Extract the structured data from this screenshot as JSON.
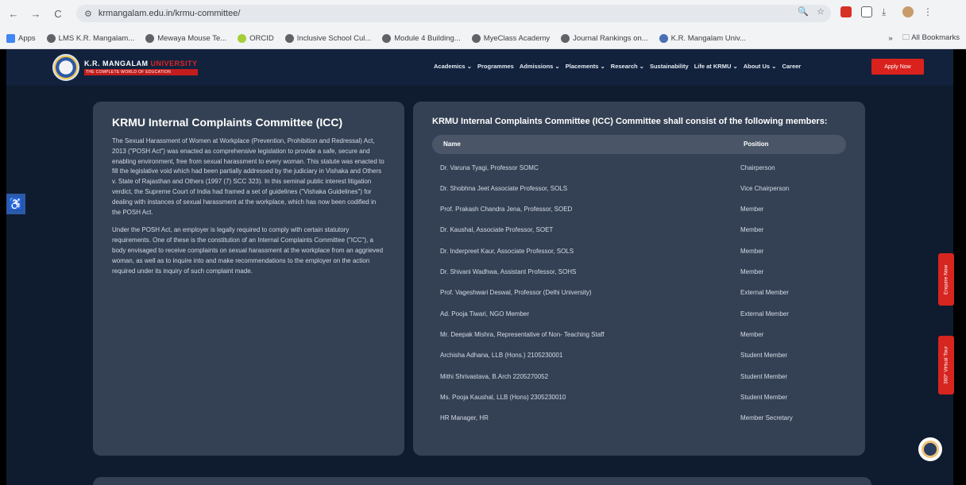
{
  "browser": {
    "url": "krmangalam.edu.in/krmu-committee/",
    "nav_back": "←",
    "nav_forward": "→",
    "nav_reload": "C",
    "site_info_icon": "tune-icon",
    "omni_icons": [
      "🔍",
      "☆"
    ],
    "bookmarks": [
      {
        "label": "Apps",
        "color": "#4285f4"
      },
      {
        "label": "LMS K.R. Mangalam...",
        "color": "#5f6368"
      },
      {
        "label": "Mewaya Mouse Te...",
        "color": "#5f6368"
      },
      {
        "label": "ORCID",
        "color": "#a6ce39"
      },
      {
        "label": "Inclusive School Cul...",
        "color": "#5f6368"
      },
      {
        "label": "Module 4 Building...",
        "color": "#5f6368"
      },
      {
        "label": "MyeClass Academy",
        "color": "#5f6368"
      },
      {
        "label": "Journal Rankings on...",
        "color": "#5f6368"
      },
      {
        "label": "K.R. Mangalam Univ...",
        "color": "#4a6fb5"
      }
    ],
    "all_bookmarks": "All Bookmarks"
  },
  "header": {
    "logo_top_a": "K.R. MANGALAM ",
    "logo_top_b": "UNIVERSITY",
    "logo_tagline": "THE COMPLETE WORLD OF EDUCATION",
    "nav": [
      "Academics ⌄",
      "Programmes",
      "Admissions ⌄",
      "Placements ⌄",
      "Research ⌄",
      "Sustainability",
      "Life at KRMU ⌄",
      "About Us ⌄",
      "Career"
    ],
    "apply_label": "Apply Now"
  },
  "left_card": {
    "title": "KRMU Internal Complaints Committee (ICC)",
    "para1": "The Sexual Harassment of Women at Workplace (Prevention, Prohibition and Redressal) Act, 2013 (\"POSH Act\") was enacted as comprehensive legislation to provide a safe, secure and enabling environment, free from sexual harassment to every woman. This statute was enacted to fill the legislative void which had been partially addressed by the judiciary in Vishaka and Others v. State of Rajasthan and Others (1997 (7) SCC 323). In this seminal public interest litigation verdict, the Supreme Court of India had framed a set of guidelines (\"Vishaka Guidelines\") for dealing with instances of sexual harassment at the workplace, which has now been codified in the POSH Act.",
    "para2": "Under the POSH Act, an employer is legally required to comply with certain statutory requirements. One of these is the constitution of an Internal Complaints Committee (\"ICC\"), a body envisaged to receive complaints on sexual harassment at the workplace from an aggrieved woman, as well as to inquire into and make recommendations to the employer on the action required under its inquiry of such complaint made."
  },
  "right_card": {
    "title": "KRMU Internal Complaints Committee (ICC) Committee shall consist of the following members:",
    "col_name": "Name",
    "col_position": "Position",
    "rows": [
      {
        "name": "Dr. Varuna Tyagi, Professor SOMC",
        "position": "Chairperson"
      },
      {
        "name": "Dr. Shobhna Jeet Associate Professor, SOLS",
        "position": "Vice Chairperson"
      },
      {
        "name": "Prof. Prakash Chandra Jena, Professor, SOED",
        "position": "Member"
      },
      {
        "name": "Dr. Kaushal, Associate Professor, SOET",
        "position": "Member"
      },
      {
        "name": "Dr. Inderpreet Kaur, Associate Professor, SOLS",
        "position": "Member"
      },
      {
        "name": "Dr. Shivani Wadhwa, Assistant Professor, SOHS",
        "position": "Member"
      },
      {
        "name": "Prof. Vageshwari Deswal, Professor (Delhi University)",
        "position": "External Member"
      },
      {
        "name": "Ad. Pooja Tiwari, NGO Member",
        "position": "External Member"
      },
      {
        "name": "Mr. Deepak Mishra, Representative of Non- Teaching Staff",
        "position": "Member"
      },
      {
        "name": "Archisha Adhana, LLB (Hons.) 2105230001",
        "position": "Student Member"
      },
      {
        "name": "Mithi Shrivastava, B.Arch 2205270052",
        "position": "Student Member"
      },
      {
        "name": "Ms. Pooja Kaushal, LLB (Hons) 2305230010",
        "position": "Student Member"
      },
      {
        "name": "HR Manager, HR",
        "position": "Member Secretary"
      }
    ]
  },
  "side_tabs": [
    "Enquire Now",
    "360° Virtual Tour"
  ],
  "accessibility_icon": "♿"
}
